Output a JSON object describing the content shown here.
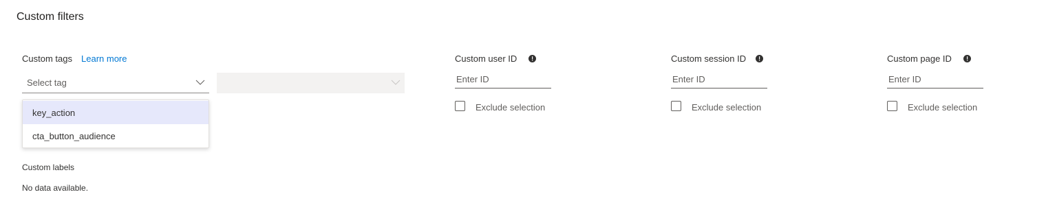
{
  "section": {
    "title": "Custom filters"
  },
  "custom_tags": {
    "label": "Custom tags",
    "learn_more": "Learn more",
    "select_placeholder": "Select tag",
    "options": [
      "key_action",
      "cta_button_audience"
    ],
    "highlighted_option": "key_action"
  },
  "custom_labels": {
    "label": "Custom labels",
    "empty_text": "No data available."
  },
  "user_id": {
    "label": "Custom user ID",
    "placeholder": "Enter ID",
    "exclude_label": "Exclude selection"
  },
  "session_id": {
    "label": "Custom session ID",
    "placeholder": "Enter ID",
    "exclude_label": "Exclude selection"
  },
  "page_id": {
    "label": "Custom page ID",
    "placeholder": "Enter ID",
    "exclude_label": "Exclude selection"
  },
  "colors": {
    "link": "#0078d4",
    "highlight": "#e6e8fb",
    "disabled_bg": "#f3f2f1"
  },
  "icons": {
    "dropdown": "chevron-down-icon",
    "info": "info-icon",
    "checkbox": "checkbox-unchecked"
  }
}
